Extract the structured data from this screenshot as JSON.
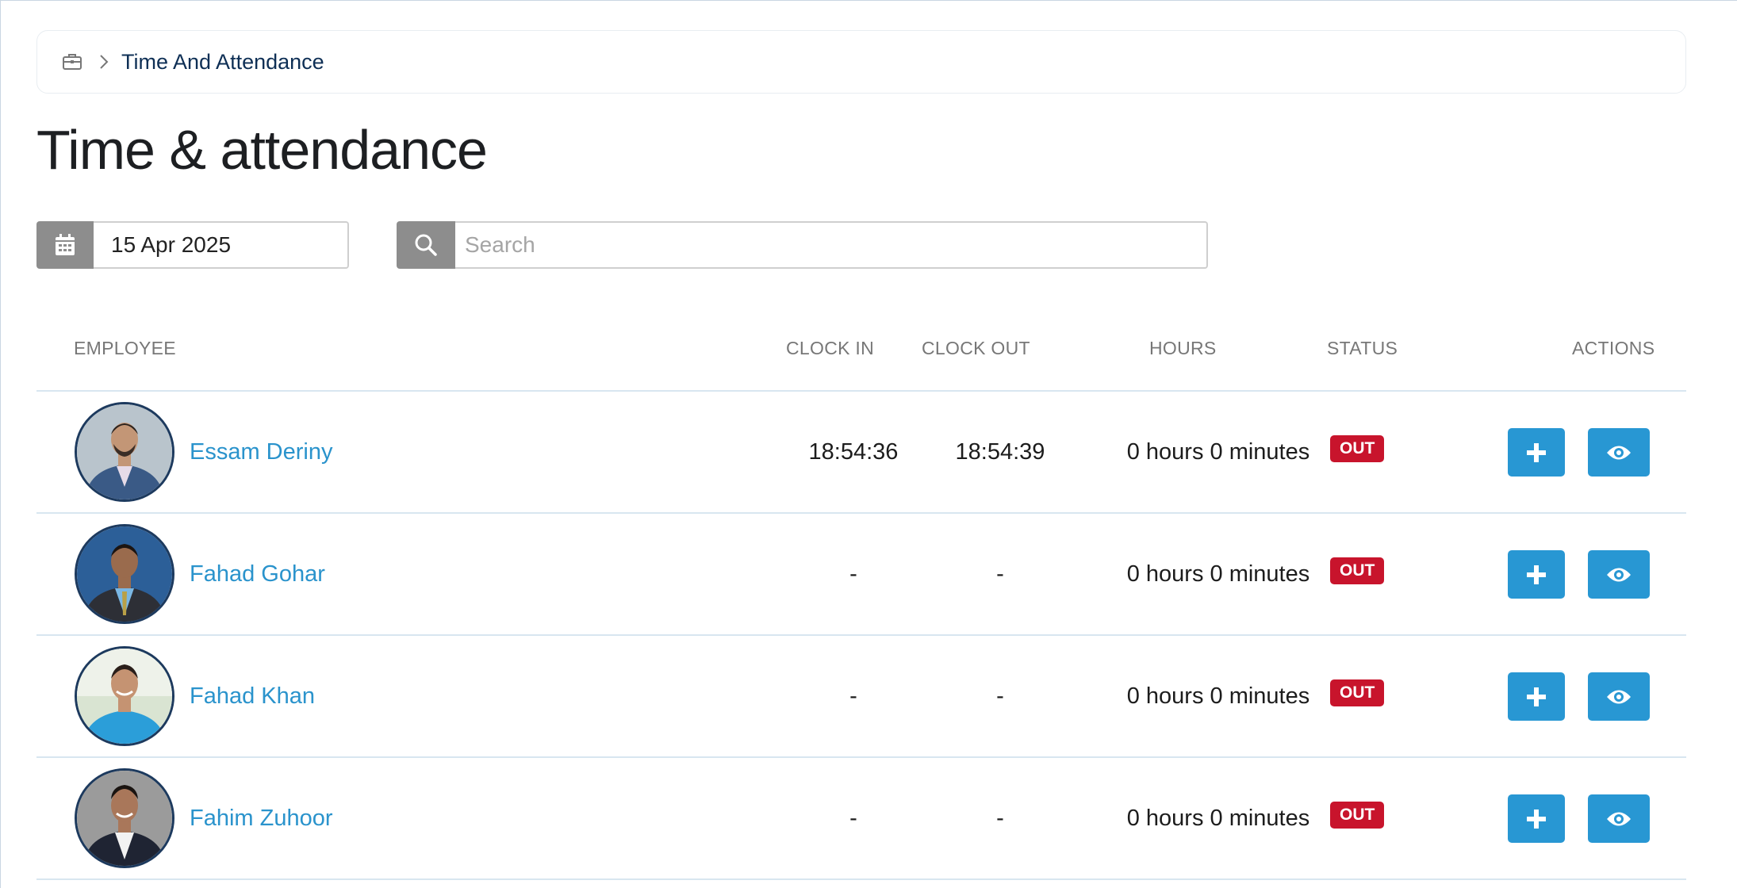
{
  "breadcrumb": {
    "home_icon": "briefcase-icon",
    "separator_icon": "chevron-right-icon",
    "current": "Time And Attendance"
  },
  "page": {
    "title": "Time & attendance"
  },
  "filters": {
    "date_icon": "calendar-icon",
    "date_value": "15 Apr 2025",
    "search_icon": "search-icon",
    "search_placeholder": "Search"
  },
  "table": {
    "headers": {
      "employee": "EMPLOYEE",
      "clock_in": "CLOCK IN",
      "clock_out": "CLOCK OUT",
      "hours": "HOURS",
      "status": "STATUS",
      "actions": "ACTIONS"
    },
    "rows": [
      {
        "name": "Essam Deriny",
        "clock_in": "18:54:36",
        "clock_out": "18:54:39",
        "hours": "0 hours 0 minutes",
        "status": "OUT"
      },
      {
        "name": "Fahad Gohar",
        "clock_in": "-",
        "clock_out": "-",
        "hours": "0 hours 0 minutes",
        "status": "OUT"
      },
      {
        "name": "Fahad Khan",
        "clock_in": "-",
        "clock_out": "-",
        "hours": "0 hours 0 minutes",
        "status": "OUT"
      },
      {
        "name": "Fahim Zuhoor",
        "clock_in": "-",
        "clock_out": "-",
        "hours": "0 hours 0 minutes",
        "status": "OUT"
      }
    ],
    "action_icons": [
      "plus-icon",
      "eye-icon"
    ]
  },
  "colors": {
    "accent": "#2897d3",
    "link": "#2a93cc",
    "status_out": "#c8142c",
    "addon_gray": "#8d8d8d",
    "breadcrumb_text": "#0e2f55"
  }
}
